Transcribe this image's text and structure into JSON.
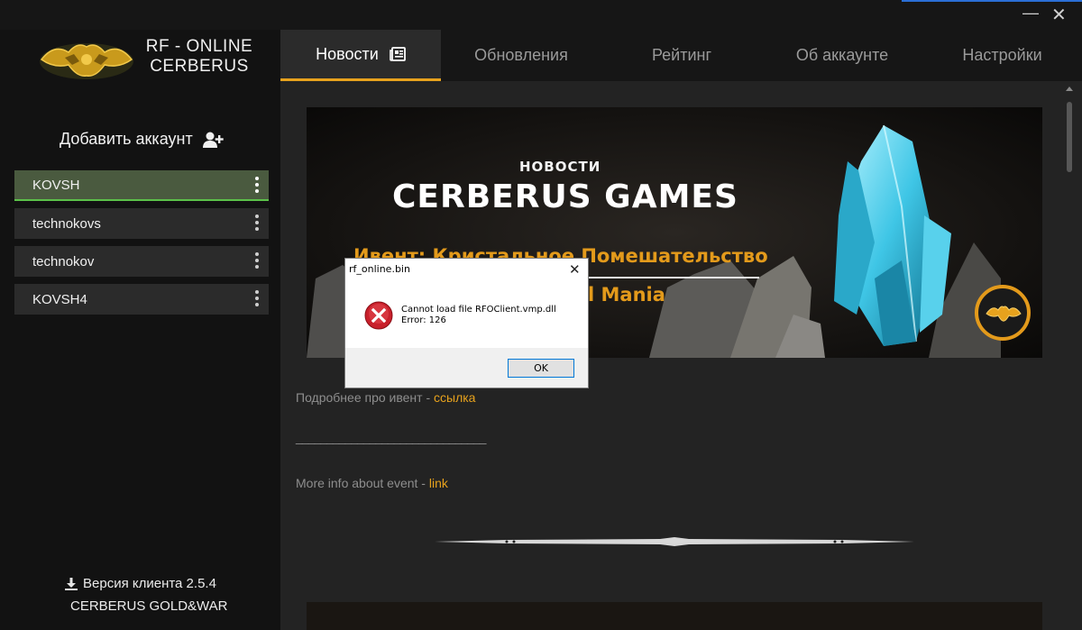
{
  "window": {
    "minimize_icon": "minimize-icon",
    "close_icon": "close-icon",
    "minimize_glyph": "—",
    "close_glyph": "✕"
  },
  "sidebar": {
    "logo_line1": "RF - ONLINE",
    "logo_line2": "CERBERUS",
    "add_account_label": "Добавить аккаунт",
    "accounts": [
      {
        "name": "KOVSH",
        "active": true
      },
      {
        "name": "technokovs",
        "active": false
      },
      {
        "name": "technokov",
        "active": false
      },
      {
        "name": "KOVSH4",
        "active": false
      }
    ],
    "version_label": "Версия клиента 2.5.4",
    "server_label": "CERBERUS GOLD&WAR"
  },
  "tabs": [
    {
      "label": "Новости",
      "active": true
    },
    {
      "label": "Обновления",
      "active": false
    },
    {
      "label": "Рейтинг",
      "active": false
    },
    {
      "label": "Об аккаунте",
      "active": false
    },
    {
      "label": "Настройки",
      "active": false
    }
  ],
  "news": {
    "banner_heading": "НОВОСТИ",
    "banner_title": "CERBERUS GAMES",
    "banner_event": "Ивент: Кристальное Помешательство",
    "banner_event_en": "l Mania",
    "more_info_ru_prefix": "Подробнее про ивент - ",
    "more_info_ru_link": "ссылка",
    "separator_line": "_______________________________",
    "more_info_en_prefix": "More info about event - ",
    "more_info_en_link": "link"
  },
  "dialog": {
    "title": "rf_online.bin",
    "message_line1": "Cannot load file RFOClient.vmp.dll",
    "message_line2": "Error: 126",
    "ok_label": "OK",
    "close_glyph": "✕",
    "icon": "error-icon"
  },
  "colors": {
    "accent": "#e7a21d",
    "active_account_bg": "#4a5a3f",
    "active_account_line": "#5cc24a",
    "error_red": "#d0202a"
  }
}
